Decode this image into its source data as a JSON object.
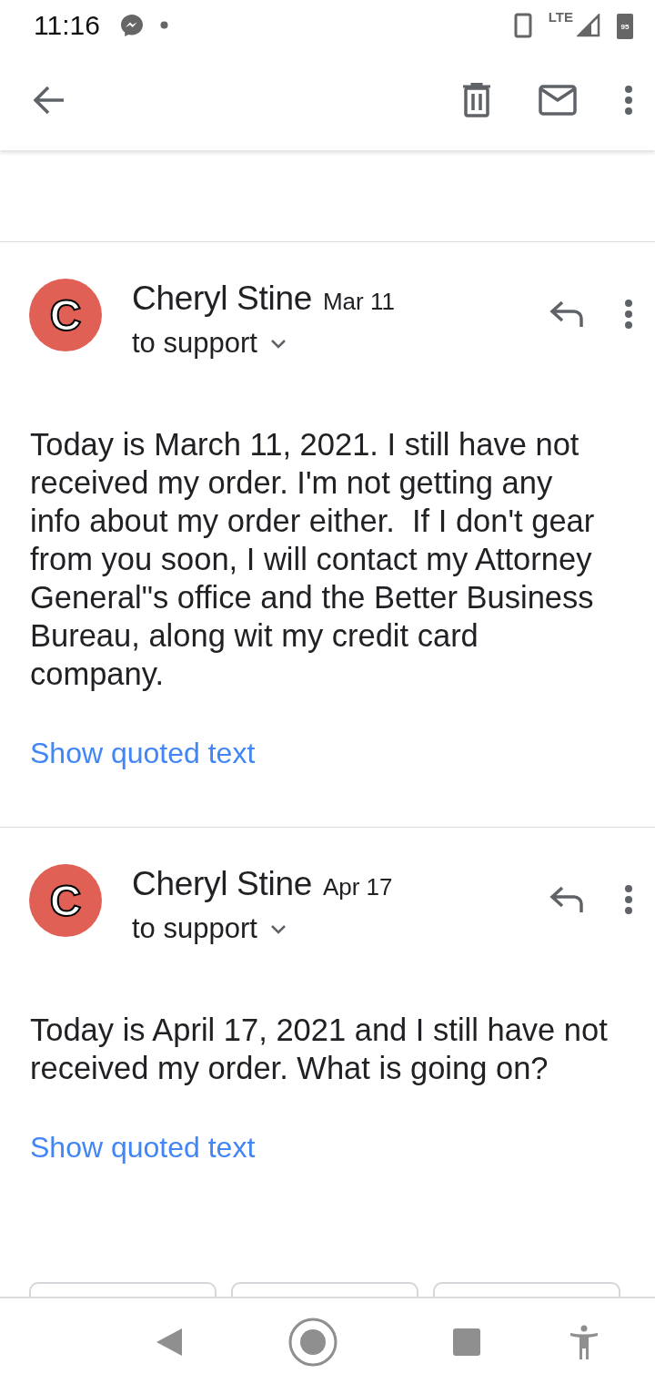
{
  "status_bar": {
    "time": "11:16",
    "network": "LTE",
    "battery": "95"
  },
  "messages": [
    {
      "avatar_letter": "C",
      "color": "#e06055",
      "sender": "Cheryl Stine",
      "date": "Mar 11",
      "recipient": "to support",
      "body": "Today is March 11, 2021. I still have not received my order. I'm not getting any info about my order either.  If I don't gear from you soon, I will contact my Attorney General\"s office and the Better Business Bureau, along wit my credit card company.",
      "link": "Show quoted text"
    },
    {
      "avatar_letter": "C",
      "color": "#e06055",
      "sender": "Cheryl Stine",
      "date": "Apr 17",
      "recipient": "to support",
      "body": "Today is April 17, 2021 and I still have not received my order. What is going on?",
      "link": "Show quoted text"
    }
  ]
}
